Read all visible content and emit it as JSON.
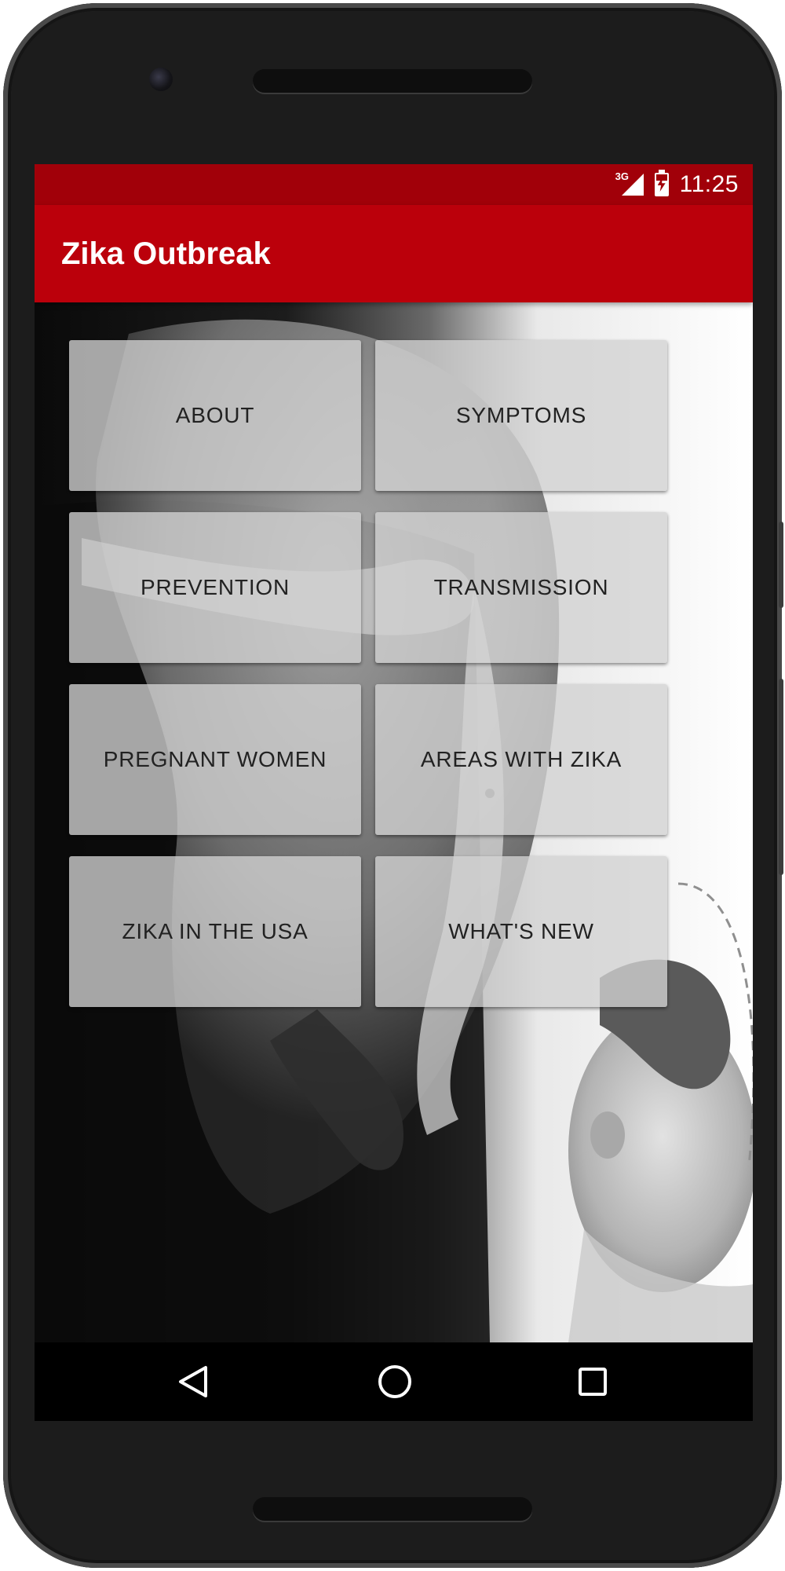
{
  "status_bar": {
    "network": "3G",
    "time": "11:25",
    "icons": [
      "signal-icon",
      "battery-charging-icon"
    ]
  },
  "app_bar": {
    "title": "Zika Outbreak"
  },
  "menu": {
    "buttons": [
      {
        "label": "ABOUT"
      },
      {
        "label": "SYMPTOMS"
      },
      {
        "label": "PREVENTION"
      },
      {
        "label": "TRANSMISSION"
      },
      {
        "label": "PREGNANT WOMEN"
      },
      {
        "label": "AREAS WITH ZIKA"
      },
      {
        "label": "ZIKA IN THE USA"
      },
      {
        "label": "WHAT'S NEW"
      }
    ]
  },
  "nav_bar": {
    "icons": [
      "back-icon",
      "home-icon",
      "recents-icon"
    ]
  },
  "colors": {
    "status_bar": "#a10009",
    "app_bar": "#bb000b",
    "button_bg": "#d2d2d2",
    "button_text": "#222222"
  }
}
